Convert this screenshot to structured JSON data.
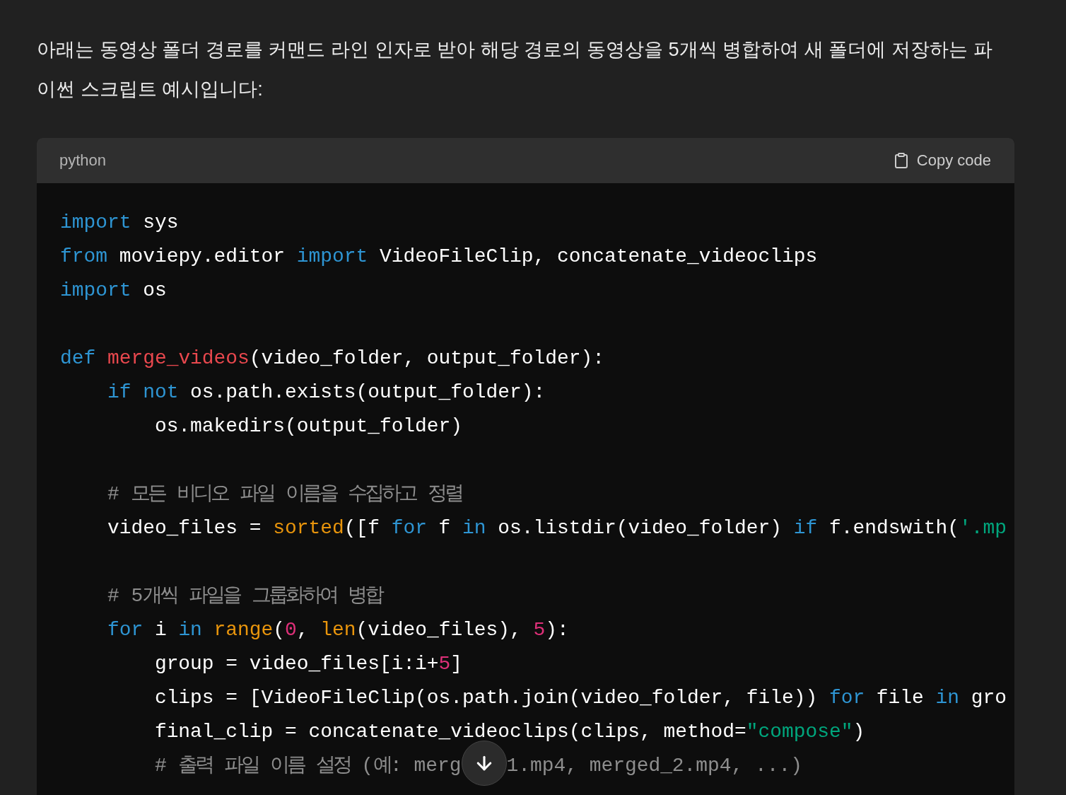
{
  "message": {
    "text": "아래는 동영상 폴더 경로를 커맨드 라인 인자로 받아 해당 경로의 동영상을 5개씩 병합하여 새 폴더에 저장하는 파이썬 스크립트 예시입니다:"
  },
  "code_block": {
    "language": "python",
    "copy_button": {
      "label": "Copy code"
    },
    "lines": [
      {
        "kind": "code",
        "tokens": [
          {
            "kind": "keyword",
            "text": "import"
          },
          {
            "kind": "plain",
            "text": " sys"
          }
        ]
      },
      {
        "kind": "code",
        "tokens": [
          {
            "kind": "keyword",
            "text": "from"
          },
          {
            "kind": "plain",
            "text": " moviepy.editor "
          },
          {
            "kind": "keyword",
            "text": "import"
          },
          {
            "kind": "plain",
            "text": " VideoFileClip, concatenate_videoclips"
          }
        ]
      },
      {
        "kind": "code",
        "tokens": [
          {
            "kind": "keyword",
            "text": "import"
          },
          {
            "kind": "plain",
            "text": " os"
          }
        ]
      },
      {
        "kind": "blank"
      },
      {
        "kind": "code",
        "tokens": [
          {
            "kind": "keyword",
            "text": "def"
          },
          {
            "kind": "function",
            "text": " merge_videos"
          },
          {
            "kind": "plain",
            "text": "(video_folder, output_folder):"
          }
        ]
      },
      {
        "kind": "code",
        "tokens": [
          {
            "kind": "keyword",
            "text": "    if"
          },
          {
            "kind": "keyword",
            "text": " not"
          },
          {
            "kind": "plain",
            "text": " os.path.exists(output_folder):"
          }
        ]
      },
      {
        "kind": "code",
        "tokens": [
          {
            "kind": "plain",
            "text": "        os.makedirs(output_folder)"
          }
        ]
      },
      {
        "kind": "blank"
      },
      {
        "kind": "code",
        "tokens": [
          {
            "kind": "comment",
            "text": "    # 모든 비디오 파일 이름을 수집하고 정렬"
          }
        ]
      },
      {
        "kind": "code",
        "tokens": [
          {
            "kind": "plain",
            "text": "    video_files = "
          },
          {
            "kind": "builtin",
            "text": "sorted"
          },
          {
            "kind": "plain",
            "text": "([f "
          },
          {
            "kind": "keyword",
            "text": "for"
          },
          {
            "kind": "plain",
            "text": " f "
          },
          {
            "kind": "keyword",
            "text": "in"
          },
          {
            "kind": "plain",
            "text": " os.listdir(video_folder) "
          },
          {
            "kind": "keyword",
            "text": "if"
          },
          {
            "kind": "plain",
            "text": " f.endswith("
          },
          {
            "kind": "string",
            "text": "'.mp"
          }
        ]
      },
      {
        "kind": "blank"
      },
      {
        "kind": "code",
        "tokens": [
          {
            "kind": "comment",
            "text": "    # 5개씩 파일을 그룹화하여 병합"
          }
        ]
      },
      {
        "kind": "code",
        "tokens": [
          {
            "kind": "keyword",
            "text": "    for"
          },
          {
            "kind": "plain",
            "text": " i "
          },
          {
            "kind": "keyword",
            "text": "in"
          },
          {
            "kind": "builtin",
            "text": " range"
          },
          {
            "kind": "plain",
            "text": "("
          },
          {
            "kind": "number",
            "text": "0"
          },
          {
            "kind": "plain",
            "text": ", "
          },
          {
            "kind": "builtin",
            "text": "len"
          },
          {
            "kind": "plain",
            "text": "(video_files), "
          },
          {
            "kind": "number",
            "text": "5"
          },
          {
            "kind": "plain",
            "text": "):"
          }
        ]
      },
      {
        "kind": "code",
        "tokens": [
          {
            "kind": "plain",
            "text": "        group = video_files[i:i+"
          },
          {
            "kind": "number",
            "text": "5"
          },
          {
            "kind": "plain",
            "text": "]"
          }
        ]
      },
      {
        "kind": "code",
        "tokens": [
          {
            "kind": "plain",
            "text": "        clips = [VideoFileClip(os.path.join(video_folder, file)) "
          },
          {
            "kind": "keyword",
            "text": "for"
          },
          {
            "kind": "plain",
            "text": " file "
          },
          {
            "kind": "keyword",
            "text": "in"
          },
          {
            "kind": "plain",
            "text": " gro"
          }
        ]
      },
      {
        "kind": "code",
        "tokens": [
          {
            "kind": "plain",
            "text": "        final_clip = concatenate_videoclips(clips, method="
          },
          {
            "kind": "string",
            "text": "\"compose\""
          },
          {
            "kind": "plain",
            "text": ")"
          }
        ]
      },
      {
        "kind": "covered",
        "parts": [
          {
            "tokens": [
              {
                "kind": "comment",
                "text": "        # 출력 파일 이름 설정 (예: merg"
              }
            ]
          },
          {
            "tokens": [
              {
                "kind": "comment",
                "text": "1.mp4, merged_2.mp4, ...)"
              }
            ]
          }
        ]
      }
    ]
  }
}
